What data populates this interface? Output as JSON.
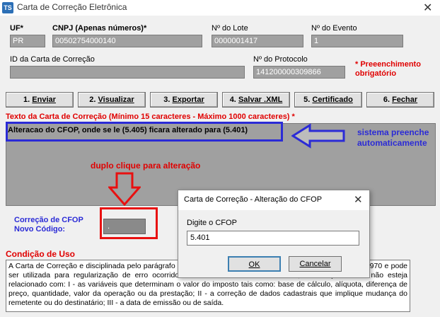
{
  "window": {
    "icon_text": "TS",
    "title": "Carta de Correção Eletrônica",
    "close": "✕"
  },
  "fields": {
    "uf_label": "UF*",
    "uf_value": "PR",
    "cnpj_label": "CNPJ (Apenas números)*",
    "cnpj_value": "00502754000140",
    "lote_label": "Nº do Lote",
    "lote_value": "0000001417",
    "evento_label": "Nº do Evento",
    "evento_value": "1",
    "id_label": "ID da Carta de Correção",
    "id_value": "",
    "protocolo_label": "Nº do Protocolo",
    "protocolo_value": "141200000309866",
    "required_note_1": "* Preeenchimento",
    "required_note_2": "obrigatório"
  },
  "toolbar": {
    "buttons": [
      {
        "key": "1.",
        "label": "Enviar"
      },
      {
        "key": "2.",
        "label": "Visualizar"
      },
      {
        "key": "3.",
        "label": "Exportar"
      },
      {
        "key": "4.",
        "label": "Salvar .XML"
      },
      {
        "key": "5.",
        "label": "Certificado"
      },
      {
        "key": "6.",
        "label": "Fechar"
      }
    ]
  },
  "texto": {
    "label": "Texto da Carta de Correção (Mínimo 15 caracteres - Máximo 1000 caracteres) *",
    "content": "Alteracao do CFOP, onde se le (5.405) ficara alterado para (5.401)"
  },
  "annotations": {
    "blue_note_1": "sistema preenche",
    "blue_note_2": "automaticamente",
    "duplo_clique": "duplo clique para alteração"
  },
  "cfop": {
    "label_1": "Correção de CFOP",
    "label_2": "Novo Código:",
    "value": "."
  },
  "condicao": {
    "label": "Condição de Uso",
    "text": "A Carta de Correção e disciplinada pelo parágrafo 1º-A do art. 7º do Convênio S/N, de 15 de dezembro de 1970 e pode ser utilizada para regularização de erro ocorrido na emissão de documento fiscal, desde que o erro não esteja relacionado com: I - as variáveis que determinam o valor do imposto tais como: base de cálculo, alíquota, diferença de preço, quantidade, valor da operação ou da prestação; II - a correção de dados cadastrais que implique mudança do remetente ou do destinatário; III - a data de emissão ou de saída."
  },
  "dialog": {
    "title": "Carta de Correção - Alteração do CFOP",
    "close": "✕",
    "prompt": "Digite o CFOP",
    "input_value": "5.401",
    "ok_label": "OK",
    "cancel_label": "Cancelar"
  }
}
